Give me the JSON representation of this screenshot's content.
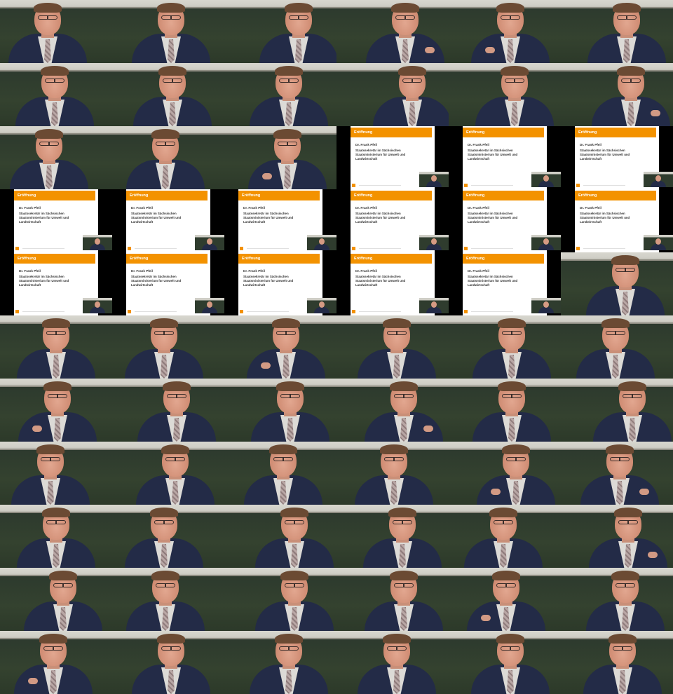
{
  "slide": {
    "header": "Eröffnung",
    "speaker_name": "Dr. Frank Pfeil",
    "speaker_role": "Staatssekretär im Sächsischen Staatsministerium für Umwelt und Landwirtschaft"
  },
  "colors": {
    "slide_accent": "#f39200",
    "jacket": "#232b47",
    "board": "#34422f"
  },
  "frames": [
    "speaker",
    "speaker",
    "speaker",
    "speaker",
    "speaker",
    "speaker",
    "speaker",
    "speaker",
    "speaker",
    "speaker",
    "speaker",
    "speaker",
    "speaker",
    "speaker",
    "speaker",
    "slide",
    "slide",
    "slide",
    "slide",
    "slide",
    "slide",
    "slide",
    "slide",
    "slide",
    "slide",
    "slide",
    "slide",
    "slide",
    "slide",
    "speaker",
    "speaker",
    "speaker",
    "speaker",
    "speaker",
    "speaker",
    "speaker",
    "speaker",
    "speaker",
    "speaker",
    "speaker",
    "speaker",
    "speaker",
    "speaker",
    "speaker",
    "speaker",
    "speaker",
    "speaker",
    "speaker",
    "speaker",
    "speaker",
    "speaker",
    "speaker",
    "speaker",
    "speaker",
    "speaker",
    "speaker",
    "speaker",
    "speaker",
    "speaker",
    "speaker",
    "speaker",
    "speaker",
    "speaker",
    "speaker",
    "speaker",
    "speaker"
  ]
}
